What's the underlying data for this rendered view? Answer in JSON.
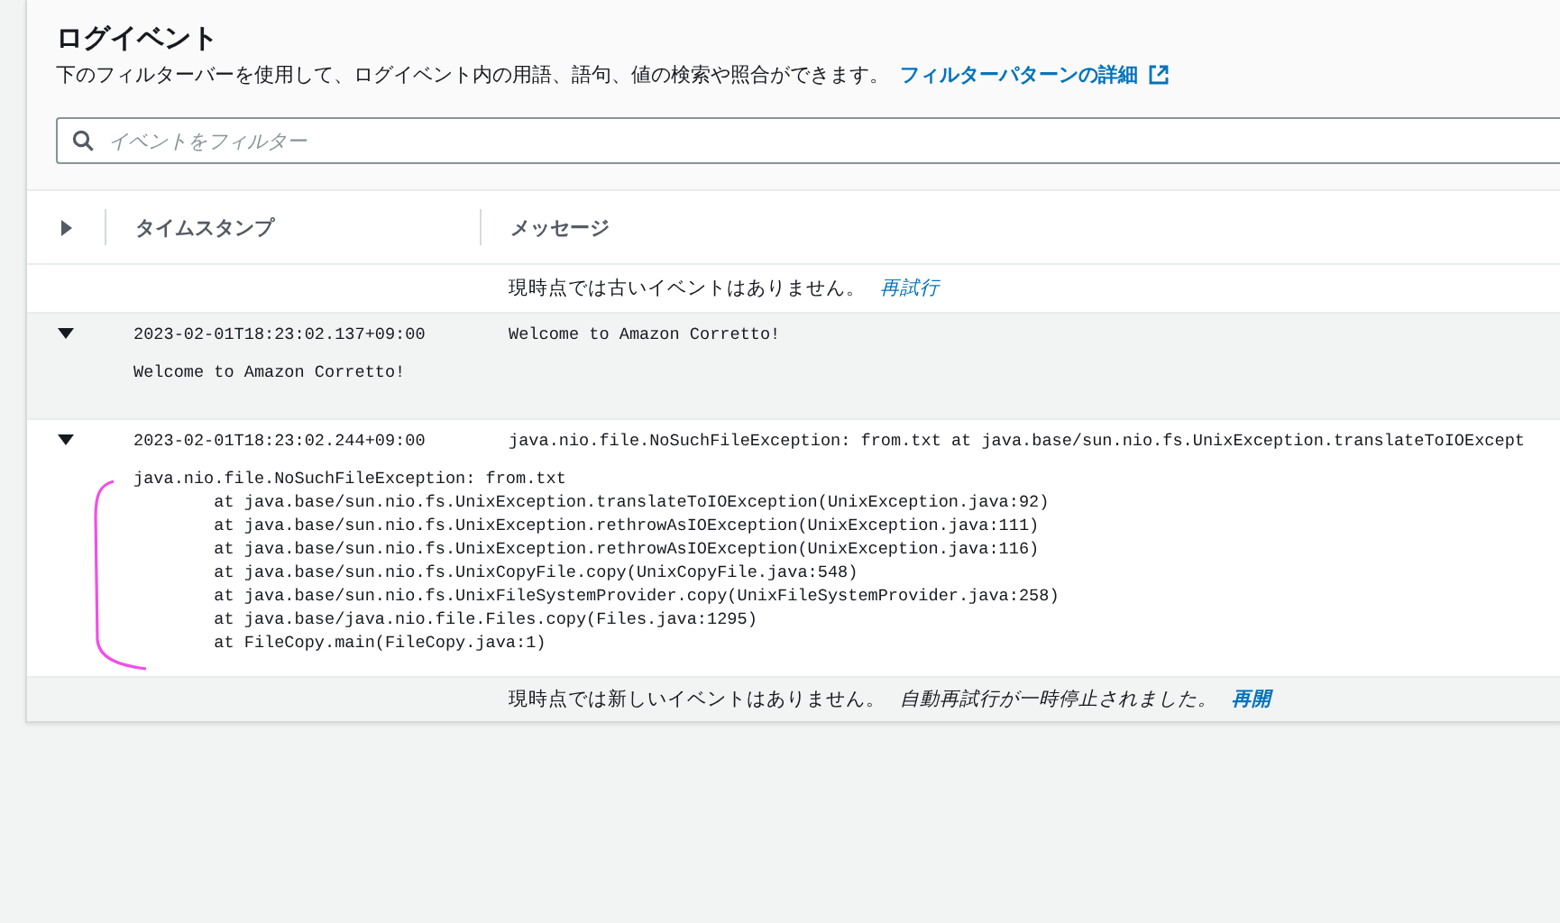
{
  "header": {
    "title": "ログイベント",
    "description": "下のフィルターバーを使用して、ログイベント内の用語、語句、値の検索や照合ができます。",
    "link": "フィルターパターンの詳細"
  },
  "filter": {
    "placeholder": "イベントをフィルター"
  },
  "table": {
    "columns": [
      "タイムスタンプ",
      "メッセージ"
    ],
    "top_notice": {
      "text": "現時点では古いイベントはありません。",
      "action": "再試行"
    },
    "rows": [
      {
        "timestamp": "2023-02-01T18:23:02.137+09:00",
        "message": "Welcome to Amazon Corretto!",
        "expanded": true,
        "highlighted": true,
        "details": [
          "Welcome to Amazon Corretto!"
        ]
      },
      {
        "timestamp": "2023-02-01T18:23:02.244+09:00",
        "message": "java.nio.file.NoSuchFileException: from.txt at java.base/sun.nio.fs.UnixException.translateToIOExcept",
        "expanded": true,
        "highlighted": false,
        "details": [
          "java.nio.file.NoSuchFileException: from.txt",
          "        at java.base/sun.nio.fs.UnixException.translateToIOException(UnixException.java:92)",
          "        at java.base/sun.nio.fs.UnixException.rethrowAsIOException(UnixException.java:111)",
          "        at java.base/sun.nio.fs.UnixException.rethrowAsIOException(UnixException.java:116)",
          "        at java.base/sun.nio.fs.UnixCopyFile.copy(UnixCopyFile.java:548)",
          "        at java.base/sun.nio.fs.UnixFileSystemProvider.copy(UnixFileSystemProvider.java:258)",
          "        at java.base/java.nio.file.Files.copy(Files.java:1295)",
          "        at FileCopy.main(FileCopy.java:1)"
        ],
        "annotated": true
      }
    ],
    "bottom_notice": {
      "text": "現時点では新しいイベントはありません。",
      "note": "自動再試行が一時停止されました。",
      "action": "再開"
    }
  }
}
